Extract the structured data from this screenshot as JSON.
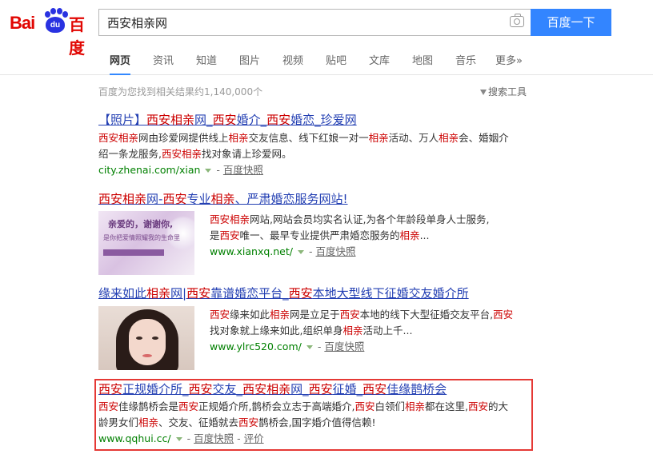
{
  "header": {
    "logo_text_left": "Bai",
    "logo_paw_text": "du",
    "logo_text_right": "百度",
    "search_value": "西安相亲网",
    "search_button": "百度一下"
  },
  "tabs": [
    {
      "label": "网页",
      "active": true
    },
    {
      "label": "资讯"
    },
    {
      "label": "知道"
    },
    {
      "label": "图片"
    },
    {
      "label": "视频"
    },
    {
      "label": "贴吧"
    },
    {
      "label": "文库"
    },
    {
      "label": "地图"
    },
    {
      "label": "音乐"
    },
    {
      "label": "更多»"
    }
  ],
  "result_count": "百度为您找到相关结果约1,140,000个",
  "search_tools": "搜索工具",
  "results": [
    {
      "title": "【照片】西安相亲网_西安婚介_西安婚恋_珍爱网",
      "abstract_line1": "西安相亲网由珍爱网提供线上相亲交友信息、线下红娘一对一相亲活动、万人相亲会、婚姻介",
      "abstract_line2": "绍一条龙服务,西安相亲找对象请上珍爱网。",
      "url": "city.zhenai.com/xian",
      "snapshot": "百度快照"
    },
    {
      "title": "西安相亲网-西安专业相亲、严肃婚恋服务网站!",
      "abstract_line1": "西安相亲网站,网站会员均实名认证,为各个年龄段单身人士服务,",
      "abstract_line2": "是西安唯一、最早专业提供严肃婚恋服务的相亲...",
      "url": "www.xianxq.net/",
      "snapshot": "百度快照",
      "thumb_text_a": "亲爱的，谢谢你,",
      "thumb_text_b": "是你把爱情照耀我的生命里"
    },
    {
      "title": "缘来如此相亲网|西安靠谱婚恋平台_西安本地大型线下征婚交友婚介所",
      "abstract_line1": "西安缘来如此相亲网是立足于西安本地的线下大型征婚交友平台,西安",
      "abstract_line2": "找对象就上缘来如此,组织单身相亲活动上千...",
      "url": "www.ylrc520.com/",
      "snapshot": "百度快照"
    },
    {
      "title": "西安正规婚介所_西安交友_西安相亲网_西安征婚_西安佳缘鹊桥会",
      "abstract_line1": "西安佳缘鹊桥会是西安正规婚介所,鹊桥会立志于高端婚介,西安白领们相亲都在这里,西安的大",
      "abstract_line2": "龄男女们相亲、交友、征婚就去西安鹊桥会,国字婚介值得信赖!",
      "url": "www.qqhui.cc/",
      "snapshot": "百度快照",
      "review": "评价"
    }
  ],
  "colors": {
    "link": "#2440b3",
    "highlight": "#c00",
    "url": "#008000",
    "button": "#3385ff",
    "annotation_box": "#e53935"
  }
}
